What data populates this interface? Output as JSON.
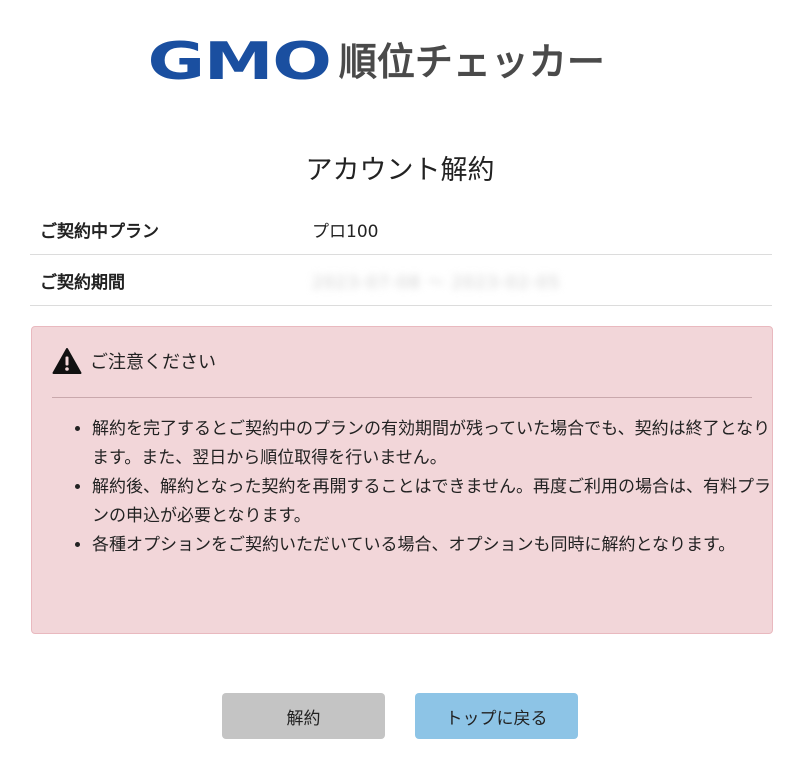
{
  "logo": {
    "brand": "GMO",
    "product": "順位チェッカー",
    "brand_color": "#1a4fa0"
  },
  "page_title": "アカウント解約",
  "info": {
    "plan_label": "ご契約中プラン",
    "plan_value": "プロ100",
    "period_label": "ご契約期間",
    "period_value": "2023-07-08 〜 2023-02-05"
  },
  "notice": {
    "icon": "warning-icon",
    "heading": "ご注意ください",
    "background_color": "#f2d6d9",
    "items": [
      "解約を完了するとご契約中のプランの有効期間が残っていた場合でも、契約は終了となります。また、翌日から順位取得を行いません。",
      "解約後、解約となった契約を再開することはできません。再度ご利用の場合は、有料プランの申込が必要となります。",
      "各種オプションをご契約いただいている場合、オプションも同時に解約となります。"
    ]
  },
  "buttons": {
    "cancel_label": "解約",
    "top_label": "トップに戻る",
    "top_color": "#8dc4e6"
  }
}
